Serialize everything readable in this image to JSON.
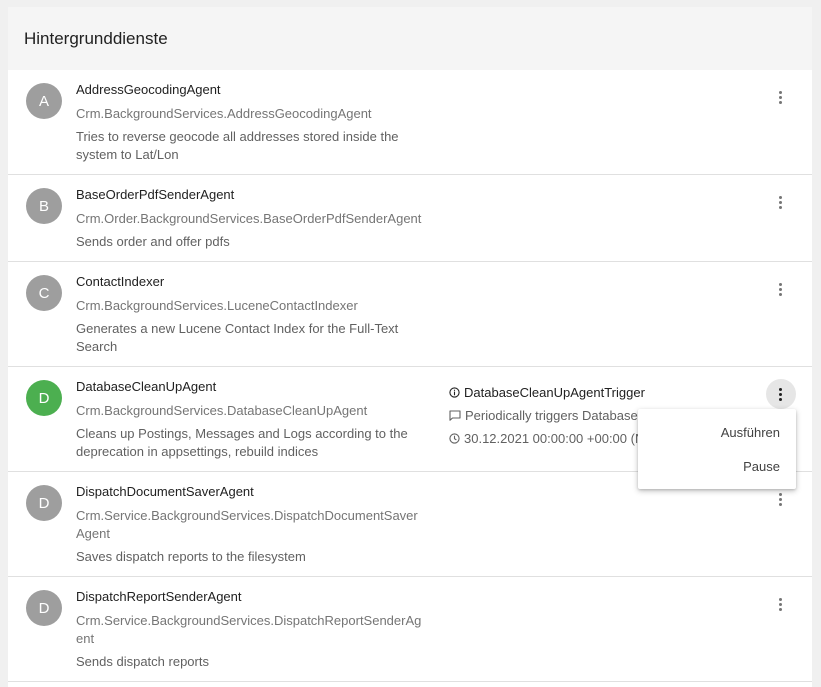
{
  "header": {
    "title": "Hintergrunddienste"
  },
  "services": [
    {
      "initial": "A",
      "name": "AddressGeocodingAgent",
      "class": "Crm.BackgroundServices.AddressGeocodingAgent",
      "description": "Tries to reverse geocode all addresses stored inside the system to Lat/Lon"
    },
    {
      "initial": "B",
      "name": "BaseOrderPdfSenderAgent",
      "class": "Crm.Order.BackgroundServices.BaseOrderPdfSenderAgent",
      "description": "Sends order and offer pdfs"
    },
    {
      "initial": "C",
      "name": "ContactIndexer",
      "class": "Crm.BackgroundServices.LuceneContactIndexer",
      "description": "Generates a new Lucene Contact Index for the Full-Text Search"
    },
    {
      "initial": "D",
      "name": "DatabaseCleanUpAgent",
      "class": "Crm.BackgroundServices.DatabaseCleanUpAgent",
      "description": "Cleans up Postings, Messages and Logs according to the deprecation in appsettings, rebuild indices",
      "trigger": {
        "name": "DatabaseCleanUpAgentTrigger",
        "description": "Periodically triggers Database",
        "next_run": "30.12.2021 00:00:00 +00:00 (N"
      }
    },
    {
      "initial": "D",
      "name": "DispatchDocumentSaverAgent",
      "class": "Crm.Service.BackgroundServices.DispatchDocumentSaverAgent",
      "description": "Saves dispatch reports to the filesystem"
    },
    {
      "initial": "D",
      "name": "DispatchReportSenderAgent",
      "class": "Crm.Service.BackgroundServices.DispatchReportSenderAgent",
      "description": "Sends dispatch reports"
    }
  ],
  "context_menu": {
    "run_label": "Ausführen",
    "pause_label": "Pause"
  },
  "colors": {
    "avatar_default": "#9e9e9e",
    "avatar_active": "#4caf50"
  }
}
